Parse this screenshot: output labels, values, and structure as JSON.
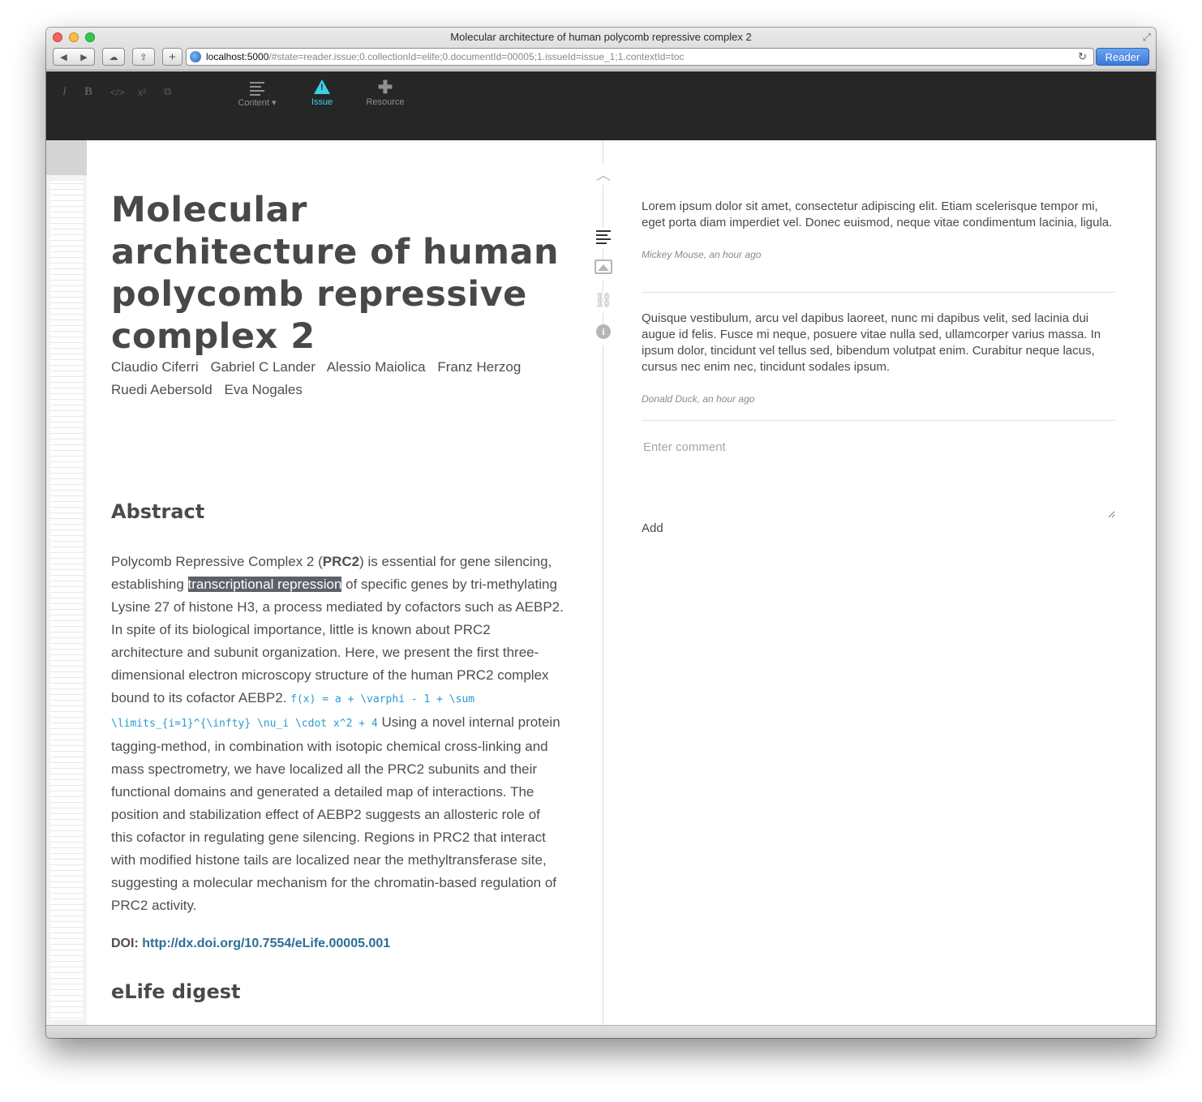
{
  "window": {
    "title": "Molecular architecture of human polycomb repressive complex 2"
  },
  "browser": {
    "url_host": "localhost:5000",
    "url_rest": "/#state=reader.issue;0.collectionId=elife;0.documentId=00005;1.issueId=issue_1;1.contextId=toc",
    "reader_label": "Reader",
    "back_icon": "back-arrow-icon",
    "forward_icon": "forward-arrow-icon"
  },
  "toolbar": {
    "format": {
      "italic": "I",
      "bold": "B",
      "code": "</>",
      "superscript": "x²",
      "link_icon": "external-link-icon"
    },
    "tools": [
      {
        "label": "Content",
        "icon": "content-lines-icon"
      },
      {
        "label": "Issue",
        "icon": "warning-icon"
      },
      {
        "label": "Resource",
        "icon": "plus-icon"
      }
    ],
    "active_color": "#3ad0e6"
  },
  "document": {
    "title": "Molecular architecture of human polycomb repressive complex 2",
    "authors": [
      "Claudio Ciferri",
      "Gabriel C Lander",
      "Alessio Maiolica",
      "Franz Herzog",
      "Ruedi Aebersold",
      "Eva Nogales"
    ],
    "abstract_heading": "Abstract",
    "abstract": {
      "p1_before": "Polycomb Repressive Complex 2 (",
      "p1_bold": "PRC2",
      "p1_after": ") is essential for gene silencing, establishing ",
      "highlight": "transcriptional repression",
      "p2": " of specific genes by tri-methylating Lysine 27 of histone H3, a process mediated by cofactors such as AEBP2. In spite of its biological importance, little is known about PRC2 architecture and subunit organization. Here, we present the first three-dimensional electron microscopy structure of the human PRC2 complex bound to its cofactor AEBP2. ",
      "formula": "f(x) = a + \\varphi - 1 + \\sum \\limits_{i=1}^{\\infty} \\nu_i \\cdot x^2 + 4",
      "p3": " Using a novel internal protein tagging-method, in combination with isotopic chemical cross-linking and mass spectrometry, we have localized all the PRC2 subunits and their functional domains and generated a detailed map of interactions. The position and stabilization effect of AEBP2 suggests an allosteric role of this cofactor in regulating gene silencing. Regions in PRC2 that interact with modified histone tails are localized near the methyltransferase site, suggesting a molecular mechanism for the chromatin-based regulation of PRC2 activity."
    },
    "doi_label": "DOI:",
    "doi_link": "http://dx.doi.org/10.7554/eLife.00005.001",
    "digest_heading": "eLife digest"
  },
  "nav": {
    "icons": [
      "chevron-up-icon",
      "toc-icon",
      "figures-icon",
      "link-icon",
      "info-icon"
    ]
  },
  "comments": {
    "items": [
      {
        "text": "Lorem ipsum dolor sit amet, consectetur adipiscing elit. Etiam scelerisque tempor mi, eget porta diam imperdiet vel. Donec euismod, neque vitae condimentum lacinia, ligula.",
        "meta": "Mickey Mouse, an hour ago"
      },
      {
        "text": "Quisque vestibulum, arcu vel dapibus laoreet, nunc mi dapibus velit, sed lacinia dui augue id felis. Fusce mi neque, posuere vitae nulla sed, ullamcorper varius massa. In ipsum dolor, tincidunt vel tellus sed, bibendum volutpat enim. Curabitur neque lacus, cursus nec enim nec, tincidunt sodales ipsum.",
        "meta": "Donald Duck, an hour ago"
      }
    ],
    "input_placeholder": "Enter comment",
    "add_label": "Add"
  }
}
